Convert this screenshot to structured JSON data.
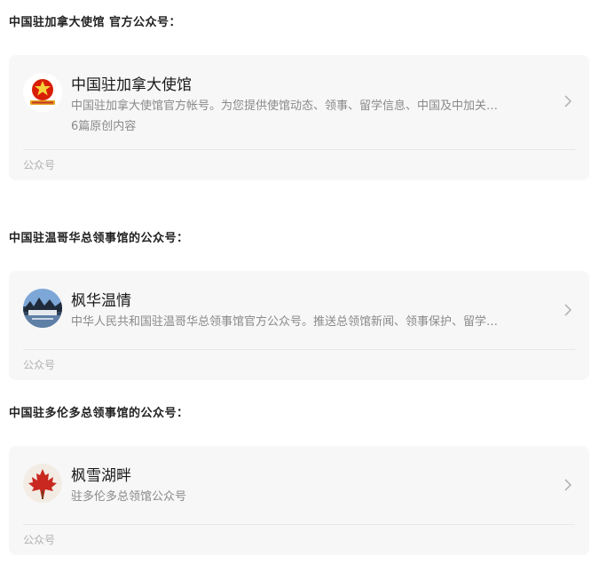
{
  "sections": [
    {
      "title": "中国驻加拿大使馆 官方公众号：",
      "account": {
        "name": "中国驻加拿大使馆",
        "description": "中国驻加拿大使馆官方帐号。为您提供使馆动态、领事、留学信息、中国及中加关…",
        "count": "6篇原创内容",
        "footer": "公众号",
        "avatar_icon": "embassy-emblem-icon"
      }
    },
    {
      "title": "中国驻温哥华总领事馆的公众号：",
      "account": {
        "name": "枫华温情",
        "description": "中华人民共和国驻温哥华总领事馆官方公众号。推送总领馆新闻、领事保护、留学…",
        "footer": "公众号",
        "avatar_icon": "landscape-photo-icon"
      }
    },
    {
      "title": "中国驻多伦多总领事馆的公众号：",
      "account": {
        "name": "枫雪湖畔",
        "description": "驻多伦多总领馆公众号",
        "footer": "公众号",
        "avatar_icon": "maple-leaf-icon"
      }
    }
  ],
  "colors": {
    "card_bg": "#f7f7f7",
    "secondary_text": "#8a8a8a",
    "footer_text": "#b0b0b0"
  }
}
